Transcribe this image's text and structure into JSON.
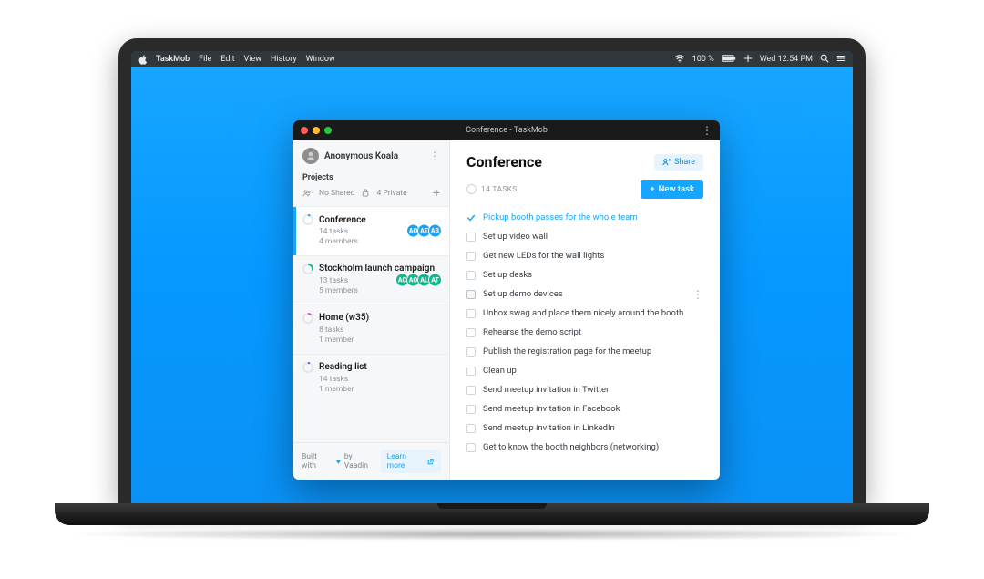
{
  "menubar": {
    "app_name": "TaskMob",
    "menus": [
      "File",
      "Edit",
      "View",
      "History",
      "Window"
    ],
    "battery": "100 %",
    "clock": "Wed 12.54 PM"
  },
  "window": {
    "title": "Conference - TaskMob"
  },
  "sidebar": {
    "user_name": "Anonymous Koala",
    "projects_label": "Projects",
    "no_shared": "No Shared",
    "private_count": "4 Private",
    "footer_prefix": "Built with",
    "footer_suffix": "by Vaadin",
    "learn_more": "Learn more",
    "projects": [
      {
        "name": "Conference",
        "tasks": "14 tasks",
        "members": "4 members",
        "color": "#1aa4f5",
        "pct": "30deg",
        "avatars": [
          "AO",
          "AE",
          "AB"
        ],
        "avcolor": "#1aa4f5"
      },
      {
        "name": "Stockholm launch campaign",
        "tasks": "13 tasks",
        "members": "5 members",
        "color": "#0fb98b",
        "pct": "110deg",
        "avatars": [
          "AC",
          "AO",
          "AL",
          "AT"
        ],
        "avcolor": "#0fb98b"
      },
      {
        "name": "Home (w35)",
        "tasks": "8 tasks",
        "members": "1 member",
        "color": "#d84fbb",
        "pct": "40deg",
        "avatars": [],
        "avcolor": "#d84fbb"
      },
      {
        "name": "Reading list",
        "tasks": "14 tasks",
        "members": "1 member",
        "color": "#7b56d6",
        "pct": "25deg",
        "avatars": [],
        "avcolor": "#7b56d6"
      }
    ]
  },
  "main": {
    "title": "Conference",
    "share": "Share",
    "task_count": "14 TASKS",
    "new_task": "New task",
    "tasks": [
      {
        "text": "Pickup booth passes for the whole team",
        "done": true
      },
      {
        "text": "Set up video wall"
      },
      {
        "text": "Get new LEDs for the wall lights"
      },
      {
        "text": "Set up desks"
      },
      {
        "text": "Set up demo devices",
        "selected": true
      },
      {
        "text": "Unbox swag and place them nicely around the booth"
      },
      {
        "text": "Rehearse the demo script"
      },
      {
        "text": "Publish the registration page for the meetup"
      },
      {
        "text": "Clean up"
      },
      {
        "text": "Send meetup invitation in Twitter"
      },
      {
        "text": "Send meetup invitation in Facebook"
      },
      {
        "text": "Send meetup invitation in LinkedIn"
      },
      {
        "text": "Get to know the booth neighbors (networking)"
      }
    ]
  }
}
